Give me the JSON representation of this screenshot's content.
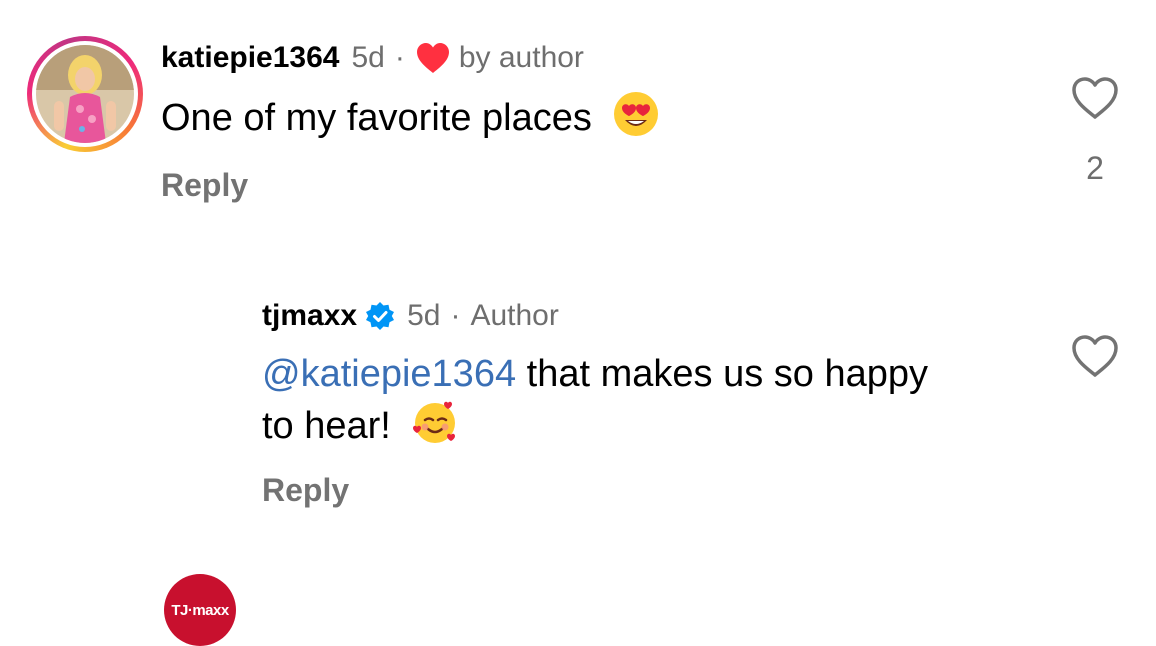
{
  "comments": [
    {
      "username": "katiepie1364",
      "time": "5d",
      "author_like_label": "by author",
      "text": "One of my favorite places",
      "emoji": "heart-eyes-emoji",
      "reply_label": "Reply",
      "like_count": "2"
    },
    {
      "username": "tjmaxx",
      "time": "5d",
      "role": "Author",
      "mention": "@katiepie1364",
      "text": " that makes us so happy to hear!",
      "emoji": "smiling-face-with-hearts-emoji",
      "reply_label": "Reply",
      "avatar_logo": "TJ·maxx"
    }
  ],
  "colors": {
    "brand_red": "#c8102e",
    "mention_blue": "#3a6fb5",
    "muted_gray": "#737373",
    "verified_blue": "#0095f6",
    "like_red": "#ff3040"
  },
  "icons": {
    "like": "heart-outline-icon",
    "author_like": "heart-filled-icon",
    "verified": "verified-badge-icon"
  }
}
